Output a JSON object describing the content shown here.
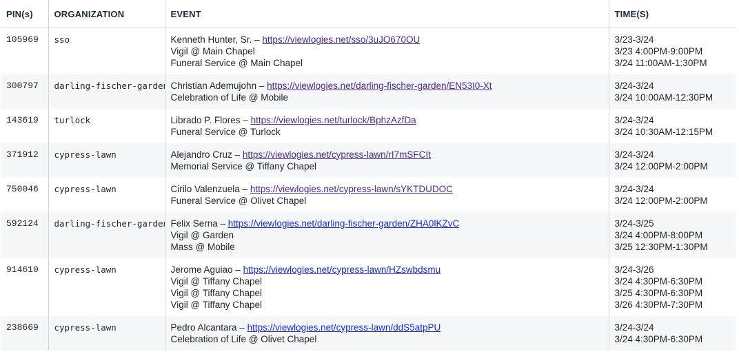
{
  "headers": {
    "pins": "PIN(s)",
    "organization": "ORGANIZATION",
    "event": "EVENT",
    "times": "TIME(S)"
  },
  "rows": [
    {
      "pin": "105969",
      "org": "sso",
      "name": "Kenneth Hunter, Sr. – ",
      "link": "https://viewlogies.net/sso/3uJO670OU",
      "visited": true,
      "events": [
        "Vigil @ Main Chapel",
        "Funeral Service @ Main Chapel"
      ],
      "range": "3/23-3/24",
      "times": [
        "3/23 4:00PM-9:00PM",
        "3/24 11:00AM-1:30PM"
      ]
    },
    {
      "pin": "300797",
      "org": "darling-fischer-garden",
      "name": "Christian Ademujohn – ",
      "link": "https://viewlogies.net/darling-fischer-garden/EN53I0-Xt",
      "visited": true,
      "events": [
        "Celebration of Life @ Mobile"
      ],
      "range": "3/24-3/24",
      "times": [
        "3/24 10:00AM-12:30PM"
      ]
    },
    {
      "pin": "143619",
      "org": "turlock",
      "name": "Librado P. Flores – ",
      "link": "https://viewlogies.net/turlock/BphzAzfDa",
      "visited": true,
      "events": [
        "Funeral Service @ Turlock"
      ],
      "range": "3/24-3/24",
      "times": [
        "3/24 10:30AM-12:15PM"
      ]
    },
    {
      "pin": "371912",
      "org": "cypress-lawn",
      "name": "Alejandro Cruz – ",
      "link": "https://viewlogies.net/cypress-lawn/rI7mSFCIt",
      "visited": true,
      "events": [
        "Memorial Service @ Tiffany Chapel"
      ],
      "range": "3/24-3/24",
      "times": [
        "3/24 12:00PM-2:00PM"
      ]
    },
    {
      "pin": "750046",
      "org": "cypress-lawn",
      "name": "Cirilo Valenzuela – ",
      "link": "https://viewlogies.net/cypress-lawn/sYKTDUDOC",
      "visited": true,
      "events": [
        "Funeral Service @ Olivet Chapel"
      ],
      "range": "3/24-3/24",
      "times": [
        "3/24 12:00PM-2:00PM"
      ]
    },
    {
      "pin": "592124",
      "org": "darling-fischer-garden",
      "name": "Felix Serna – ",
      "link": "https://viewlogies.net/darling-fischer-garden/ZHA0lKZvC",
      "visited": false,
      "events": [
        "Vigil @ Garden",
        "Mass @ Mobile"
      ],
      "range": "3/24-3/25",
      "times": [
        "3/24 4:00PM-8:00PM",
        "3/25 12:30PM-1:30PM"
      ]
    },
    {
      "pin": "914610",
      "org": "cypress-lawn",
      "name": "Jerome Aguiao – ",
      "link": "https://viewlogies.net/cypress-lawn/HZswbdsmu",
      "visited": false,
      "events": [
        "Vigil @ Tiffany Chapel",
        "Vigil @ Tiffany Chapel",
        "Vigil @ Tiffany Chapel"
      ],
      "range": "3/24-3/26",
      "times": [
        "3/24 4:30PM-6:30PM",
        "3/25 4:30PM-6:30PM",
        "3/26 4:30PM-7:30PM"
      ]
    },
    {
      "pin": "238669",
      "org": "cypress-lawn",
      "name": "Pedro Alcantara – ",
      "link": "https://viewlogies.net/cypress-lawn/ddS5atpPU",
      "visited": false,
      "events": [
        "Celebration of Life @ Olivet Chapel"
      ],
      "range": "3/24-3/24",
      "times": [
        "3/24 4:30PM-6:30PM"
      ]
    }
  ]
}
